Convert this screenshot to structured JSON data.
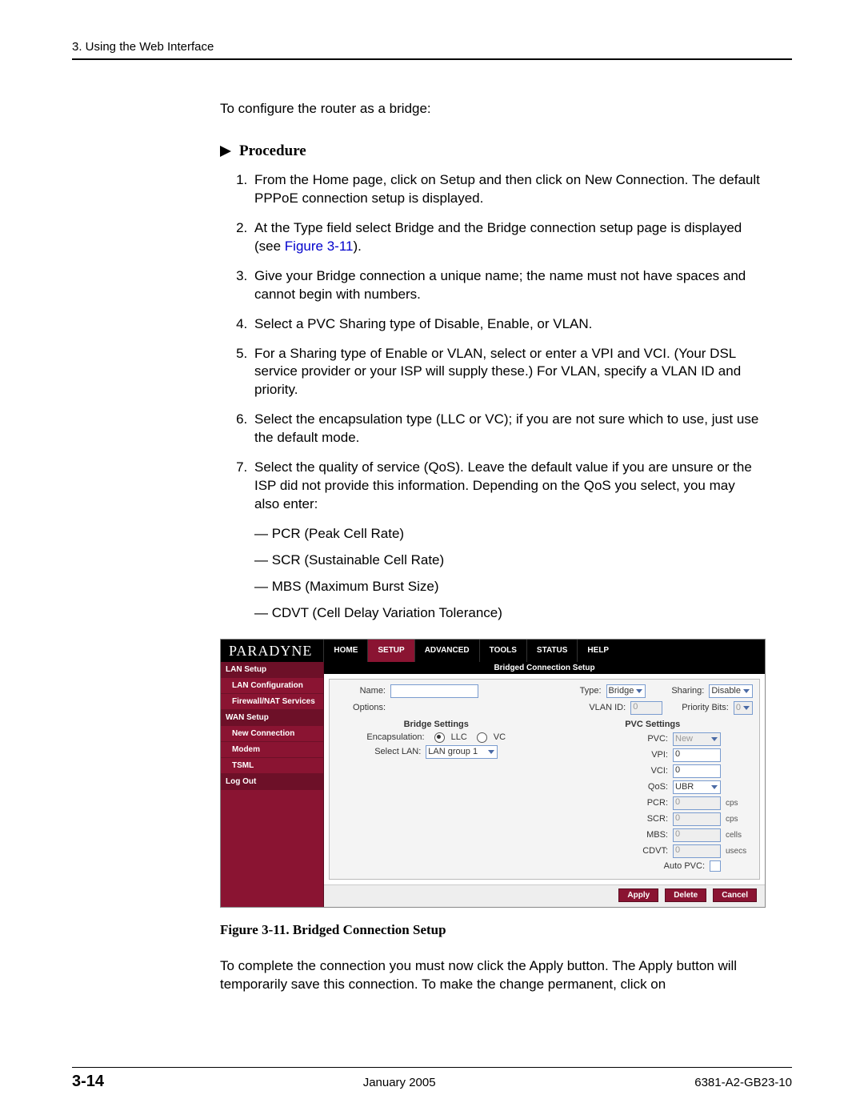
{
  "header": {
    "running": "3. Using the Web Interface"
  },
  "intro": "To configure the router as a bridge:",
  "procedure_label": "Procedure",
  "steps": {
    "s1": "From the Home page, click on Setup and then click on New Connection. The default PPPoE connection setup is displayed.",
    "s2a": "At the Type field select Bridge and the Bridge connection setup page is displayed (see ",
    "s2link": "Figure 3-11",
    "s2b": ").",
    "s3": "Give your Bridge connection a unique name; the name must not have spaces and cannot begin with numbers.",
    "s4": "Select a PVC Sharing type of Disable, Enable, or VLAN.",
    "s5": "For a Sharing type of Enable or VLAN, select or enter a VPI and VCI. (Your DSL service provider or your ISP will supply these.) For VLAN, specify a VLAN ID and priority.",
    "s6": "Select the encapsulation type (LLC or VC); if you are not sure which to use, just use the default mode.",
    "s7": "Select the quality of service (QoS). Leave the default value if you are unsure or the ISP did not provide this information. Depending on the QoS you select, you may also enter:",
    "qos": {
      "a": "PCR (Peak Cell Rate)",
      "b": "SCR (Sustainable Cell Rate)",
      "c": "MBS (Maximum Burst Size)",
      "d": "CDVT (Cell Delay Variation Tolerance)"
    }
  },
  "figure_caption": "Figure 3-11.   Bridged Connection Setup",
  "closing": "To complete the connection you must now click the Apply button. The Apply button will temporarily save this connection. To make the change permanent, click on",
  "footer": {
    "page": "3-14",
    "date": "January 2005",
    "doc": "6381-A2-GB23-10"
  },
  "ui": {
    "brand": "PARADYNE",
    "tabs": {
      "home": "HOME",
      "setup": "SETUP",
      "advanced": "ADVANCED",
      "tools": "TOOLS",
      "status": "STATUS",
      "help": "HELP"
    },
    "sidebar": {
      "lan_setup": "LAN Setup",
      "lan_conf": "LAN Configuration",
      "fw": "Firewall/NAT Services",
      "wan_setup": "WAN Setup",
      "new_conn": "New Connection",
      "modem": "Modem",
      "tsml": "TSML",
      "logout": "Log Out"
    },
    "content_title": "Bridged Connection Setup",
    "labels": {
      "name": "Name:",
      "options": "Options:",
      "type": "Type:",
      "sharing": "Sharing:",
      "vlan": "VLAN ID:",
      "prio": "Priority Bits:",
      "bridge_settings": "Bridge Settings",
      "pvc_settings": "PVC Settings",
      "encap": "Encapsulation:",
      "llc": "LLC",
      "vc": "VC",
      "select_lan": "Select LAN:",
      "lan_group": "LAN group 1",
      "pvc": "PVC:",
      "new": "New",
      "vpi": "VPI:",
      "vci": "VCI:",
      "qos": "QoS:",
      "ubr": "UBR",
      "pcr": "PCR:",
      "scr": "SCR:",
      "mbs": "MBS:",
      "cdvt": "CDVT:",
      "autopvc": "Auto PVC:",
      "cps": "cps",
      "cells": "cells",
      "usecs": "usecs",
      "type_val": "Bridge",
      "sharing_val": "Disable",
      "vlan_val": "0",
      "prio_val": "0",
      "vpi_val": "0",
      "vci_val": "0",
      "pcr_val": "0",
      "scr_val": "0",
      "mbs_val": "0",
      "cdvt_val": "0"
    },
    "buttons": {
      "apply": "Apply",
      "delete": "Delete",
      "cancel": "Cancel"
    }
  }
}
